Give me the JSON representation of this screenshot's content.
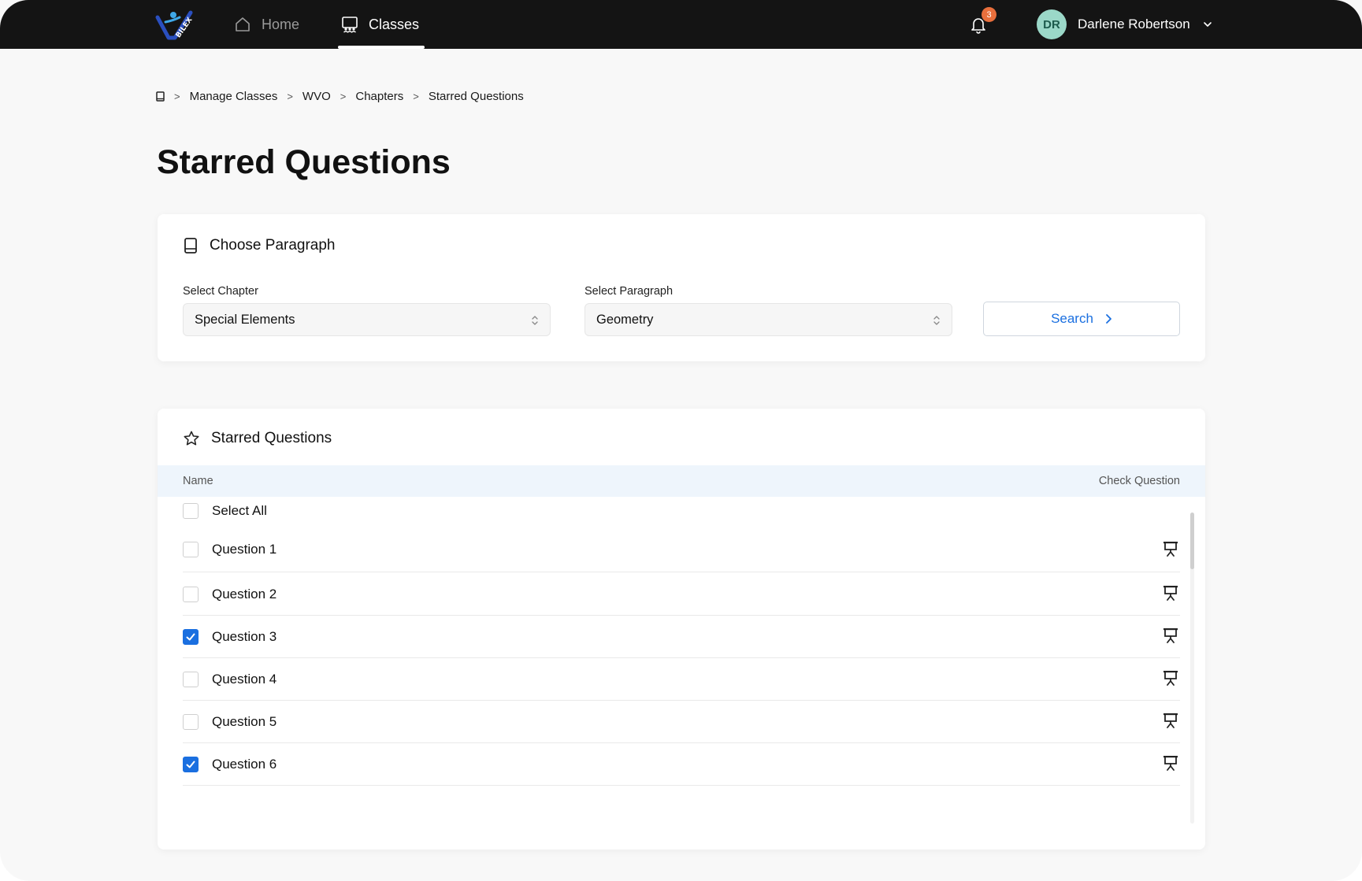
{
  "nav": {
    "logo_text": "BILEX",
    "home_label": "Home",
    "classes_label": "Classes",
    "notification_count": "3",
    "avatar_initials": "DR",
    "user_name": "Darlene Robertson"
  },
  "breadcrumb": [
    "Manage Classes",
    "WVO",
    "Chapters",
    "Starred Questions"
  ],
  "page_title": "Starred Questions",
  "choose": {
    "title": "Choose Paragraph",
    "chapter_label": "Select Chapter",
    "chapter_value": "Special Elements",
    "paragraph_label": "Select Paragraph",
    "paragraph_value": "Geometry",
    "search_label": "Search"
  },
  "starred": {
    "title": "Starred Questions",
    "col_name": "Name",
    "col_check": "Check Question",
    "select_all_label": "Select All",
    "select_all_checked": false,
    "questions": [
      {
        "label": "Question 1",
        "checked": false
      },
      {
        "label": "Question 2",
        "checked": false
      },
      {
        "label": "Question 3",
        "checked": true
      },
      {
        "label": "Question 4",
        "checked": false
      },
      {
        "label": "Question 5",
        "checked": false
      },
      {
        "label": "Question 6",
        "checked": true
      }
    ]
  },
  "colors": {
    "topbar": "#141414",
    "accent": "#1a6fe0",
    "badge": "#e96f3c",
    "avatar_bg": "#9bd8c8",
    "table_header_bg": "#eef5fc"
  }
}
